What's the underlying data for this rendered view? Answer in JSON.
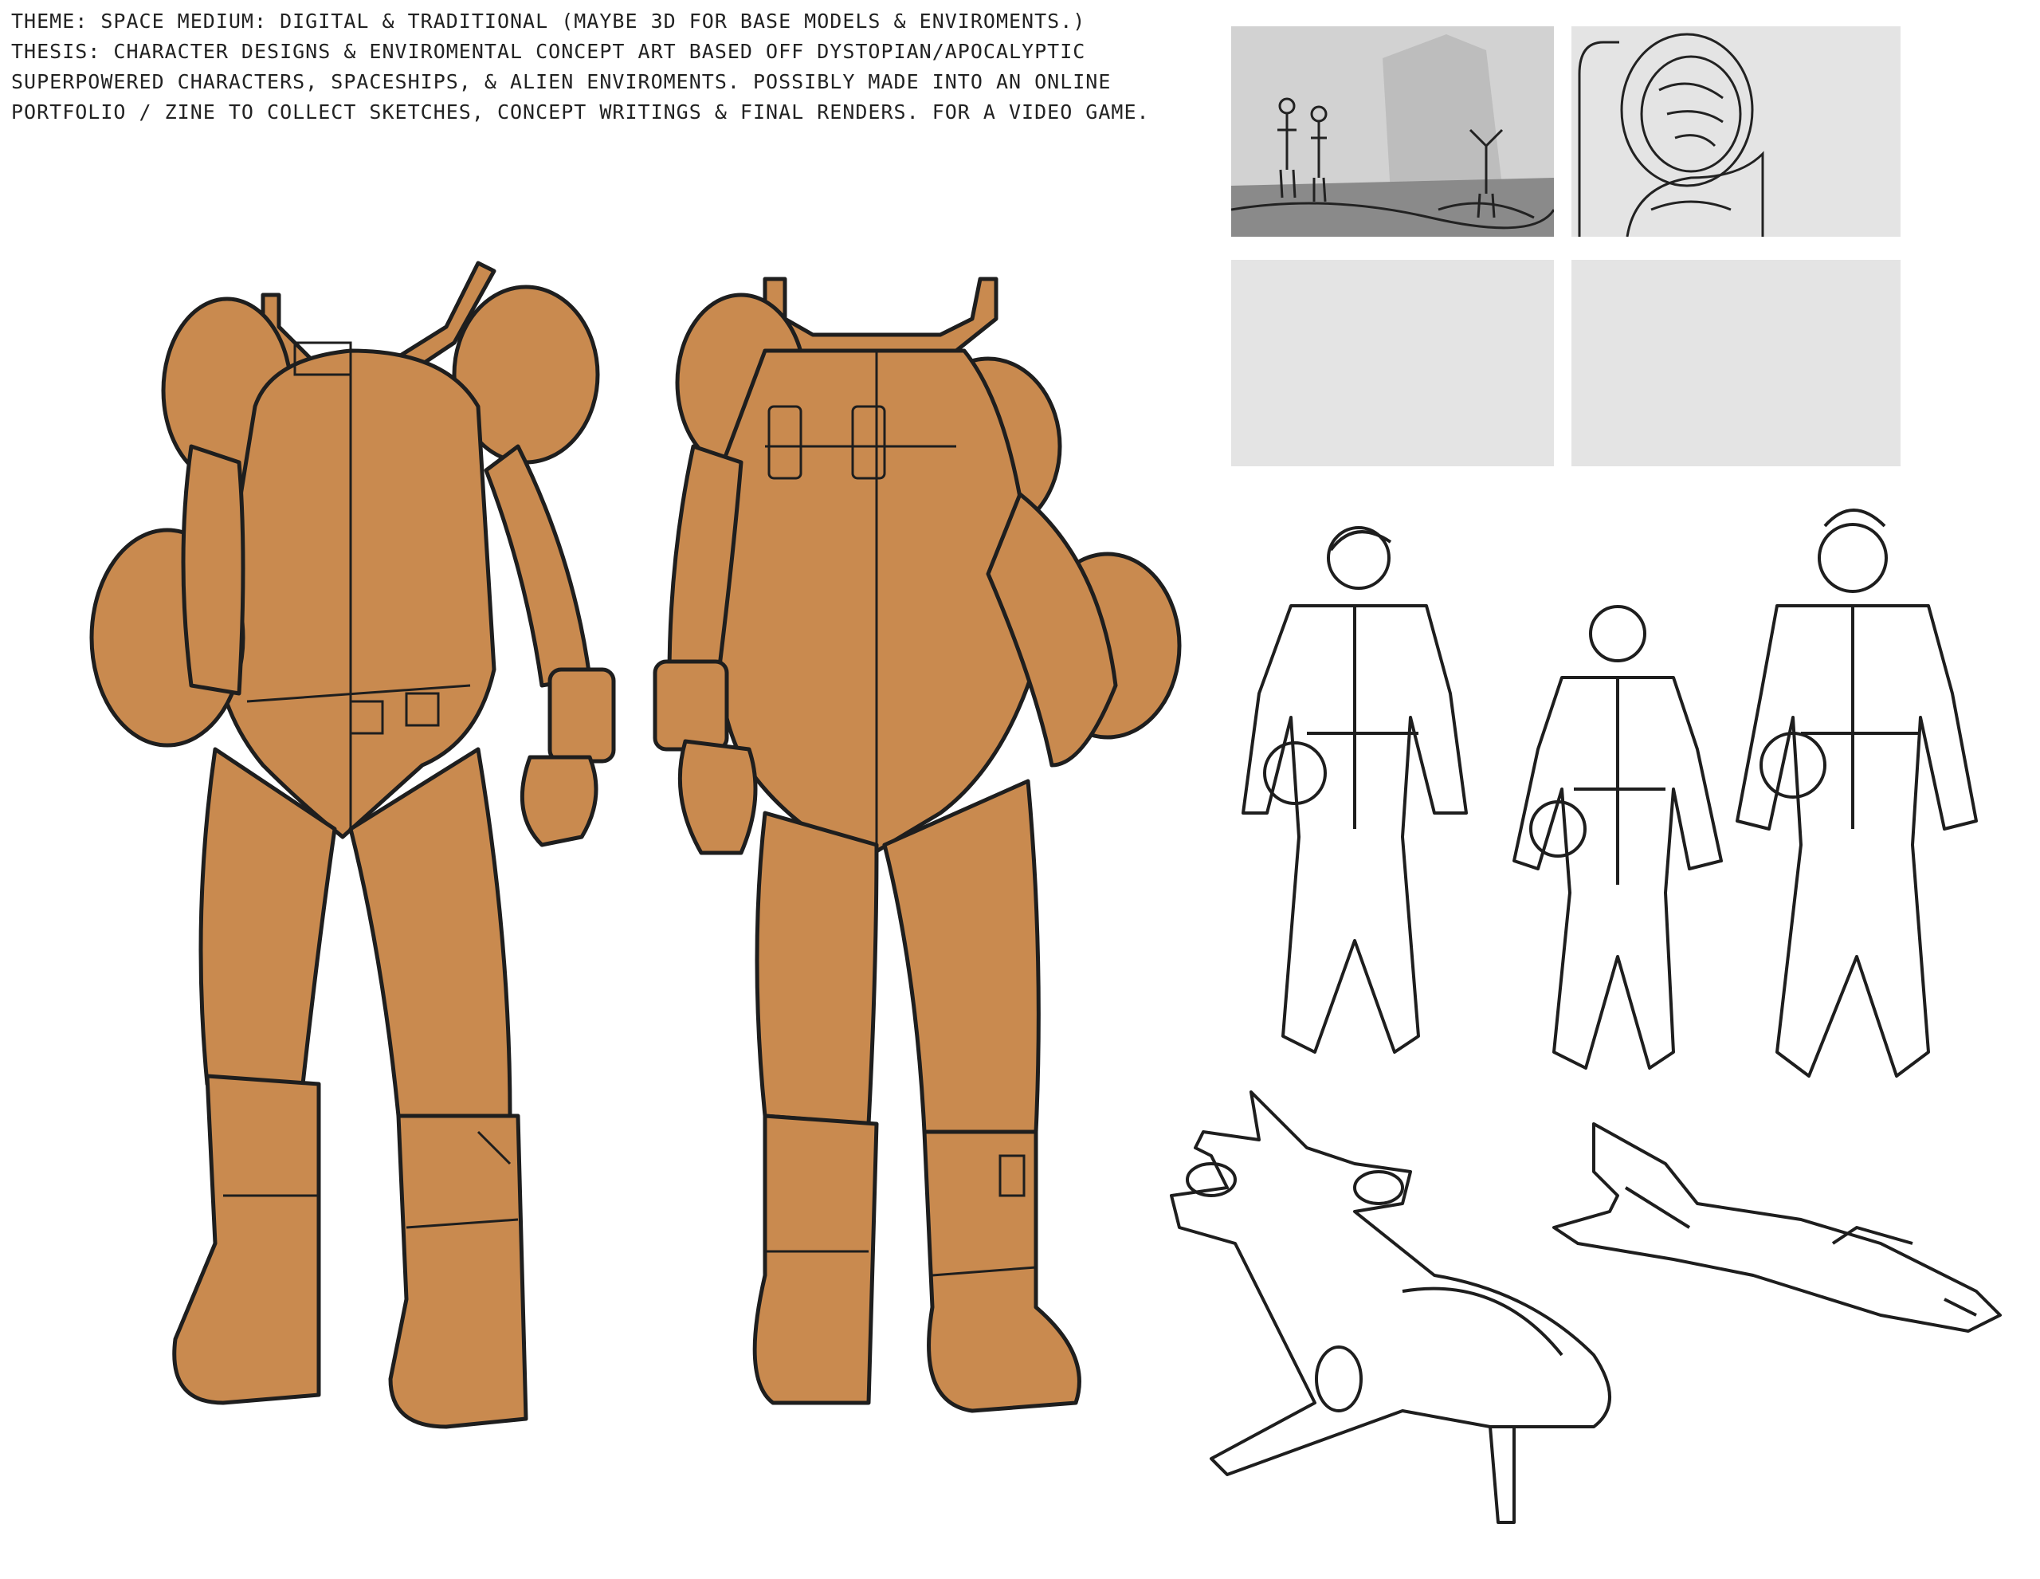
{
  "notes": {
    "line1": "THEME: SPACE    MEDIUM: DIGITAL & TRADITIONAL (MAYBE 3D FOR BASE MODELS & ENVIROMENTS.)",
    "line2": "THESIS: CHARACTER DESIGNS & ENVIROMENTAL CONCEPT ART BASED OFF DYSTOPIAN/APOCALYPTIC",
    "line3": "SUPERPOWERED CHARACTERS, SPACESHIPS, & ALIEN ENVIROMENTS. POSSIBLY MADE INTO AN ONLINE",
    "line4": "PORTFOLIO / ZINE TO COLLECT SKETCHES, CONCEPT WRITINGS & FINAL RENDERS. FOR A VIDEO GAME."
  },
  "colors": {
    "suit_fill": "#c98a4f",
    "line": "#1e1e1e",
    "panel": "#e4e4e4"
  },
  "icons": [
    "spacesuit-front",
    "spacesuit-back",
    "helmet",
    "astronaut-crew",
    "spaceship"
  ]
}
